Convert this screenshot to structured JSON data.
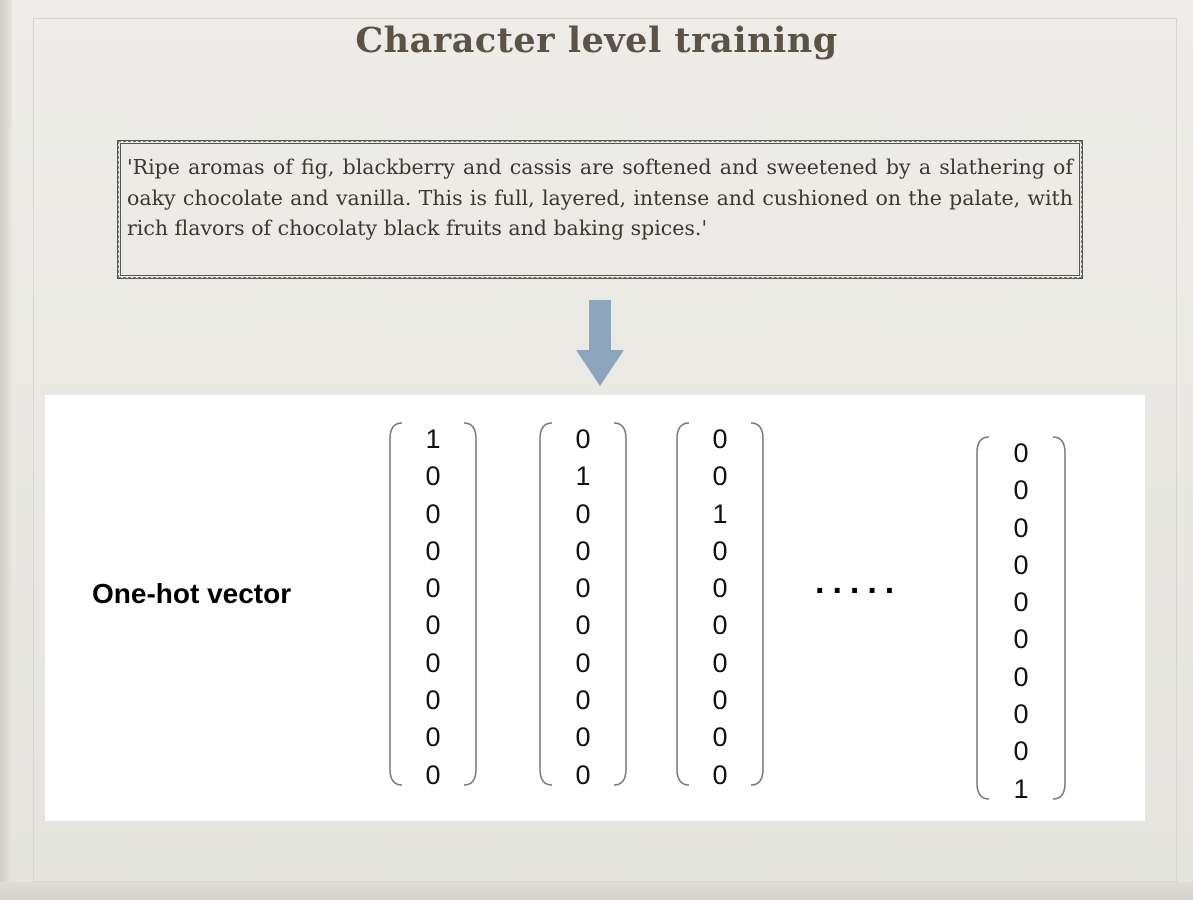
{
  "title": "Character level training",
  "quote": "'Ripe aromas of fig, blackberry and cassis are softened and sweetened by a slathering of oaky chocolate and vanilla. This is full, layered, intense and cushioned on the palate, with rich flavors of chocolaty black fruits and baking spices.'",
  "vector_label": "One-hot vector",
  "ellipsis": ".....",
  "vectors": [
    [
      "1",
      "0",
      "0",
      "0",
      "0",
      "0",
      "0",
      "0",
      "0",
      "0"
    ],
    [
      "0",
      "1",
      "0",
      "0",
      "0",
      "0",
      "0",
      "0",
      "0",
      "0"
    ],
    [
      "0",
      "0",
      "1",
      "0",
      "0",
      "0",
      "0",
      "0",
      "0",
      "0"
    ],
    [
      "0",
      "0",
      "0",
      "0",
      "0",
      "0",
      "0",
      "0",
      "0",
      "1"
    ]
  ],
  "colors": {
    "title": "#5b5348",
    "arrow": "#8ea6bd",
    "panel": "#ffffff"
  }
}
